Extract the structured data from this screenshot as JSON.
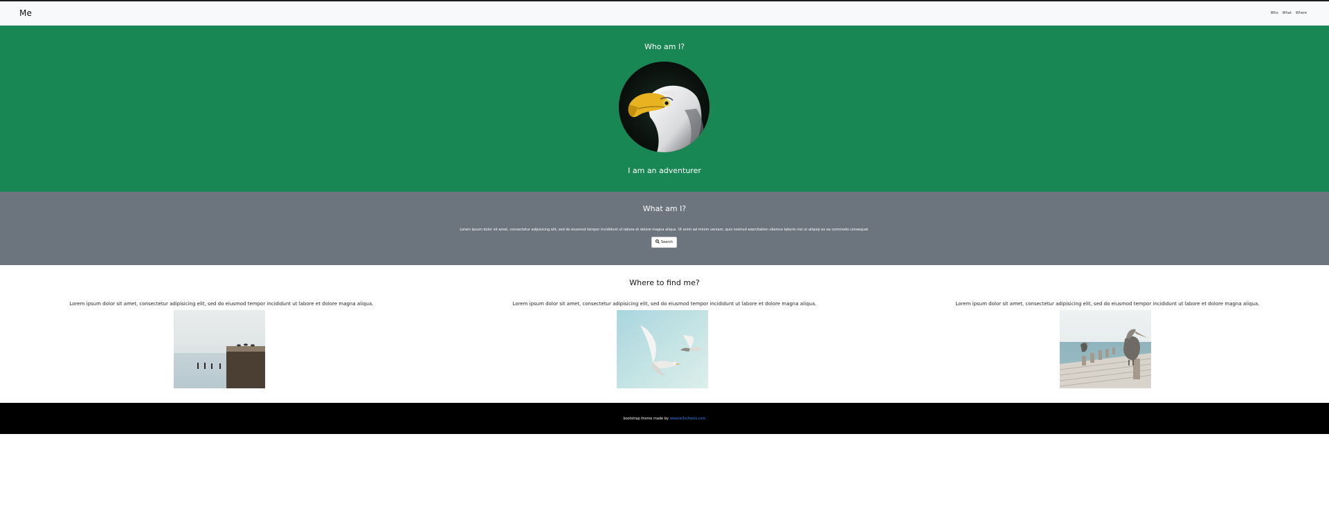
{
  "nav": {
    "brand": "Me",
    "links": [
      "Who",
      "What",
      "Where"
    ]
  },
  "who": {
    "title": "Who am I?",
    "avatar_alt": "eagle-portrait",
    "subtitle": "I am an adventurer"
  },
  "what": {
    "title": "What am I?",
    "text": "Lorem ipsum dolor sit amet, consectetur adipisicing elit, sed do eiusmod tempor incididunt ut labore et dolore magna aliqua. Ut enim ad minim veniam, quis nostrud exercitation ullamco laboris nisi ut aliquip ex ea commodo consequat.",
    "button_label": "Search",
    "button_icon": "search-icon"
  },
  "where": {
    "title": "Where to find me?",
    "columns": [
      {
        "caption": "Lorem ipsum dolor sit amet, consectetur adipisicing elit, sed do eiusmod tempor incididunt ut labore et dolore magna aliqua.",
        "image": "birds-on-pier-posts"
      },
      {
        "caption": "Lorem ipsum dolor sit amet, consectetur adipisicing elit, sed do eiusmod tempor incididunt ut labore et dolore magna aliqua.",
        "image": "seagulls-flying"
      },
      {
        "caption": "Lorem ipsum dolor sit amet, consectetur adipisicing elit, sed do eiusmod tempor incididunt ut labore et dolore magna aliqua.",
        "image": "pelican-on-dock"
      }
    ]
  },
  "footer": {
    "text": "bootstrap theme made by",
    "link": "www.w3schools.com"
  },
  "colors": {
    "green": "#198754",
    "gray": "#6c757d",
    "footer": "#000000",
    "link": "#3b82f6"
  }
}
